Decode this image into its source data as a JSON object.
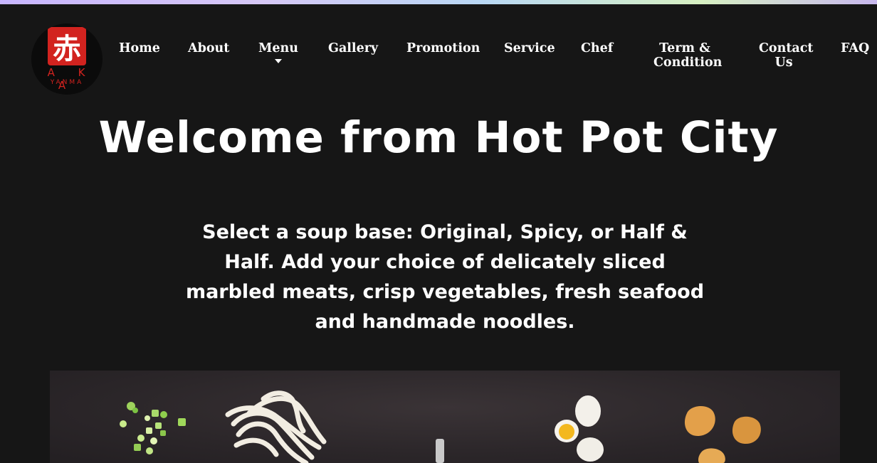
{
  "brand": {
    "glyph": "赤",
    "name": "A K A",
    "subname": "YANMA",
    "accent_color": "#d2231f"
  },
  "nav": {
    "home": "Home",
    "about": "About",
    "menu": "Menu",
    "gallery": "Gallery",
    "promotion": "Promotion",
    "service": "Service",
    "chef": "Chef",
    "terms_line1": "Term &",
    "terms_line2": "Condition",
    "contact_line1": "Contact",
    "contact_line2": "Us",
    "faq": "FAQ"
  },
  "hero": {
    "headline": "Welcome from Hot Pot City",
    "description": "Select a soup base: Original, Spicy, or Half & Half. Add your choice of delicately sliced marbled meats, crisp vegetables, fresh seafood and handmade noodles.",
    "image_subject": "hot pot ingredients: scallions, noodles, eggs, fried tofu"
  }
}
